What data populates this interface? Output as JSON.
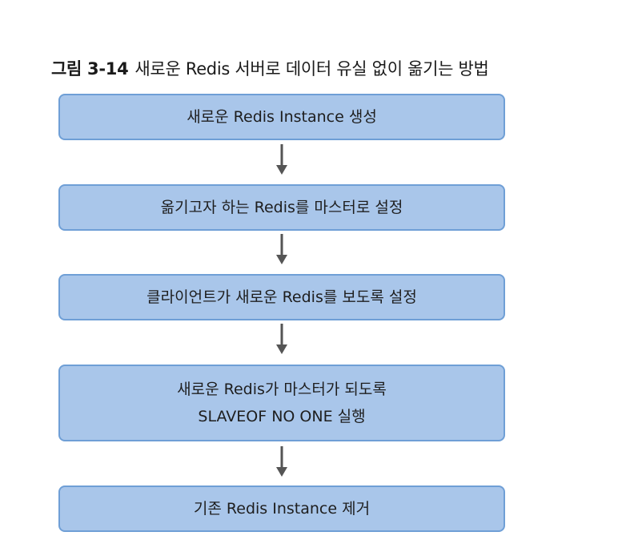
{
  "figure": {
    "number": "그림 3-14",
    "title": "새로운 Redis 서버로 데이터 유실 없이 옮기는 방법"
  },
  "steps": [
    {
      "lines": [
        "새로운 Redis Instance 생성"
      ]
    },
    {
      "lines": [
        "옮기고자 하는 Redis를 마스터로 설정"
      ]
    },
    {
      "lines": [
        "클라이언트가 새로운 Redis를 보도록 설정"
      ]
    },
    {
      "lines": [
        "새로운 Redis가 마스터가 되도록",
        "SLAVEOF NO ONE 실행"
      ]
    },
    {
      "lines": [
        "기존 Redis Instance 제거"
      ]
    }
  ],
  "colors": {
    "box_fill": "#a9c6ea",
    "box_border": "#6f9fd6",
    "arrow": "#555555"
  },
  "icons": [
    "arrow-down-icon"
  ]
}
